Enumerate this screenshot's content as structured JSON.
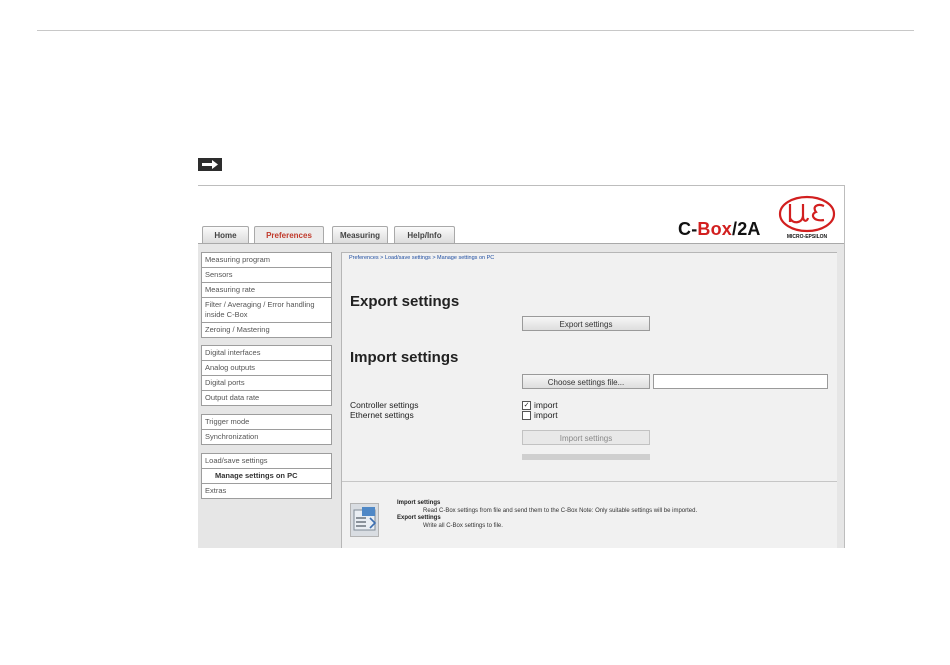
{
  "header": {
    "tabs": [
      {
        "label": "Home",
        "active": false
      },
      {
        "label": "Preferences",
        "active": true
      },
      {
        "label": "Measuring",
        "active": false
      },
      {
        "label": "Help/Info",
        "active": false
      }
    ],
    "brand_prefix": "C-",
    "brand_highlight": "Box",
    "brand_suffix": "/2A",
    "logo_text": "MICRO-EPSILON",
    "brand_color": "#d21f1f"
  },
  "sidebar": {
    "group1": [
      "Measuring program",
      "Sensors",
      "Measuring rate",
      "Filter / Averaging / Error handling inside C-Box",
      "Zeroing / Mastering"
    ],
    "group2": [
      "Digital interfaces",
      "Analog outputs",
      "Digital ports",
      "Output data rate"
    ],
    "group3": [
      "Trigger mode",
      "Synchronization"
    ],
    "group4": [
      "Load/save settings",
      "Manage settings on PC",
      "Extras"
    ]
  },
  "main": {
    "breadcrumb": "Preferences > Load/save settings > Manage settings on PC",
    "export_heading": "Export settings",
    "export_button": "Export settings",
    "import_heading": "Import settings",
    "choose_button": "Choose settings file...",
    "file_value": "",
    "controller_label": "Controller settings",
    "ethernet_label": "Ethernet settings",
    "controller_import_label": "import",
    "controller_import_checked": true,
    "ethernet_import_label": "import",
    "ethernet_import_checked": false,
    "import_button": "Import settings",
    "progress": 0
  },
  "help": {
    "import_title": "Import settings",
    "import_text": "Read C-Box settings from file and send them to the C-Box Note: Only suitable settings will be imported.",
    "export_title": "Export settings",
    "export_text": "Write all C-Box settings to file."
  }
}
